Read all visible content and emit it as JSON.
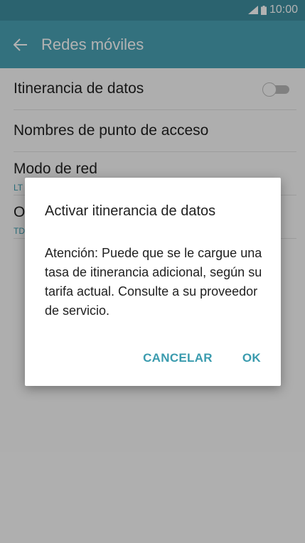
{
  "status_bar": {
    "time": "10:00",
    "icons": [
      "signal-icon",
      "battery-icon"
    ]
  },
  "app_bar": {
    "title": "Redes móviles",
    "back_icon": "arrow-left-icon"
  },
  "settings": {
    "items": [
      {
        "title": "Itinerancia de datos",
        "subtitle": "",
        "toggle_on": false
      },
      {
        "title": "Nombres de punto de acceso",
        "subtitle": ""
      },
      {
        "title": "Modo de red",
        "subtitle": "LT"
      },
      {
        "title": "O",
        "subtitle": "TD"
      }
    ]
  },
  "dialog": {
    "title": "Activar itinerancia de datos",
    "message": "Atención: Puede que se le cargue una tasa de itinerancia adicional, según su tarifa actual. Consulte a su proveedor de servicio.",
    "cancel_label": "CANCELAR",
    "ok_label": "OK"
  },
  "colors": {
    "accent": "#3a9bae",
    "app_bar": "#4aa3b5",
    "status_bar": "#3e8fa0"
  }
}
